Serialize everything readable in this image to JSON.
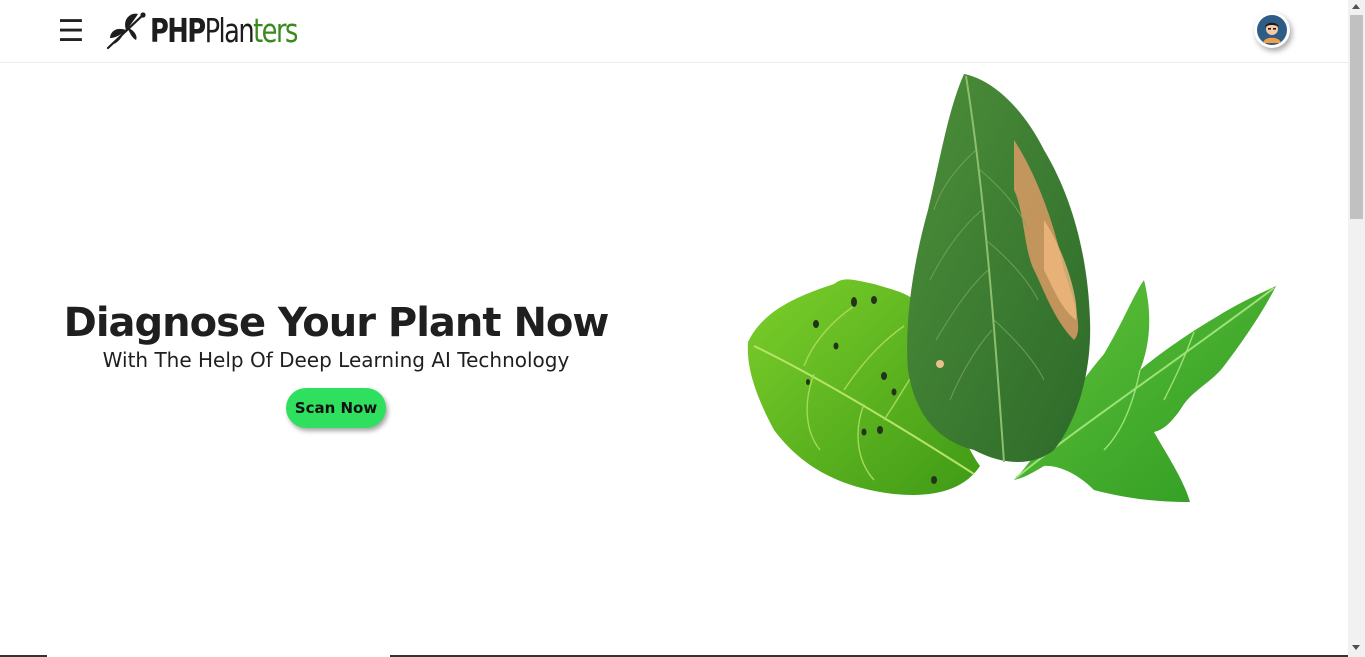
{
  "header": {
    "menu_icon": "hamburger-menu-icon",
    "logo": {
      "part_php": "PHP",
      "part_plan": "Plan",
      "part_ters": "ters",
      "icon": "dragonfly-icon"
    },
    "avatar_icon": "user-avatar-icon"
  },
  "hero": {
    "title": "Diagnose Your Plant Now",
    "subtitle": "With The Help Of Deep Learning AI Technology",
    "cta_label": "Scan Now",
    "image": "leaves-illustration"
  },
  "colors": {
    "accent_green": "#2ee05e",
    "logo_green": "#3a8a1e",
    "text_dark": "#1f1f1f"
  }
}
